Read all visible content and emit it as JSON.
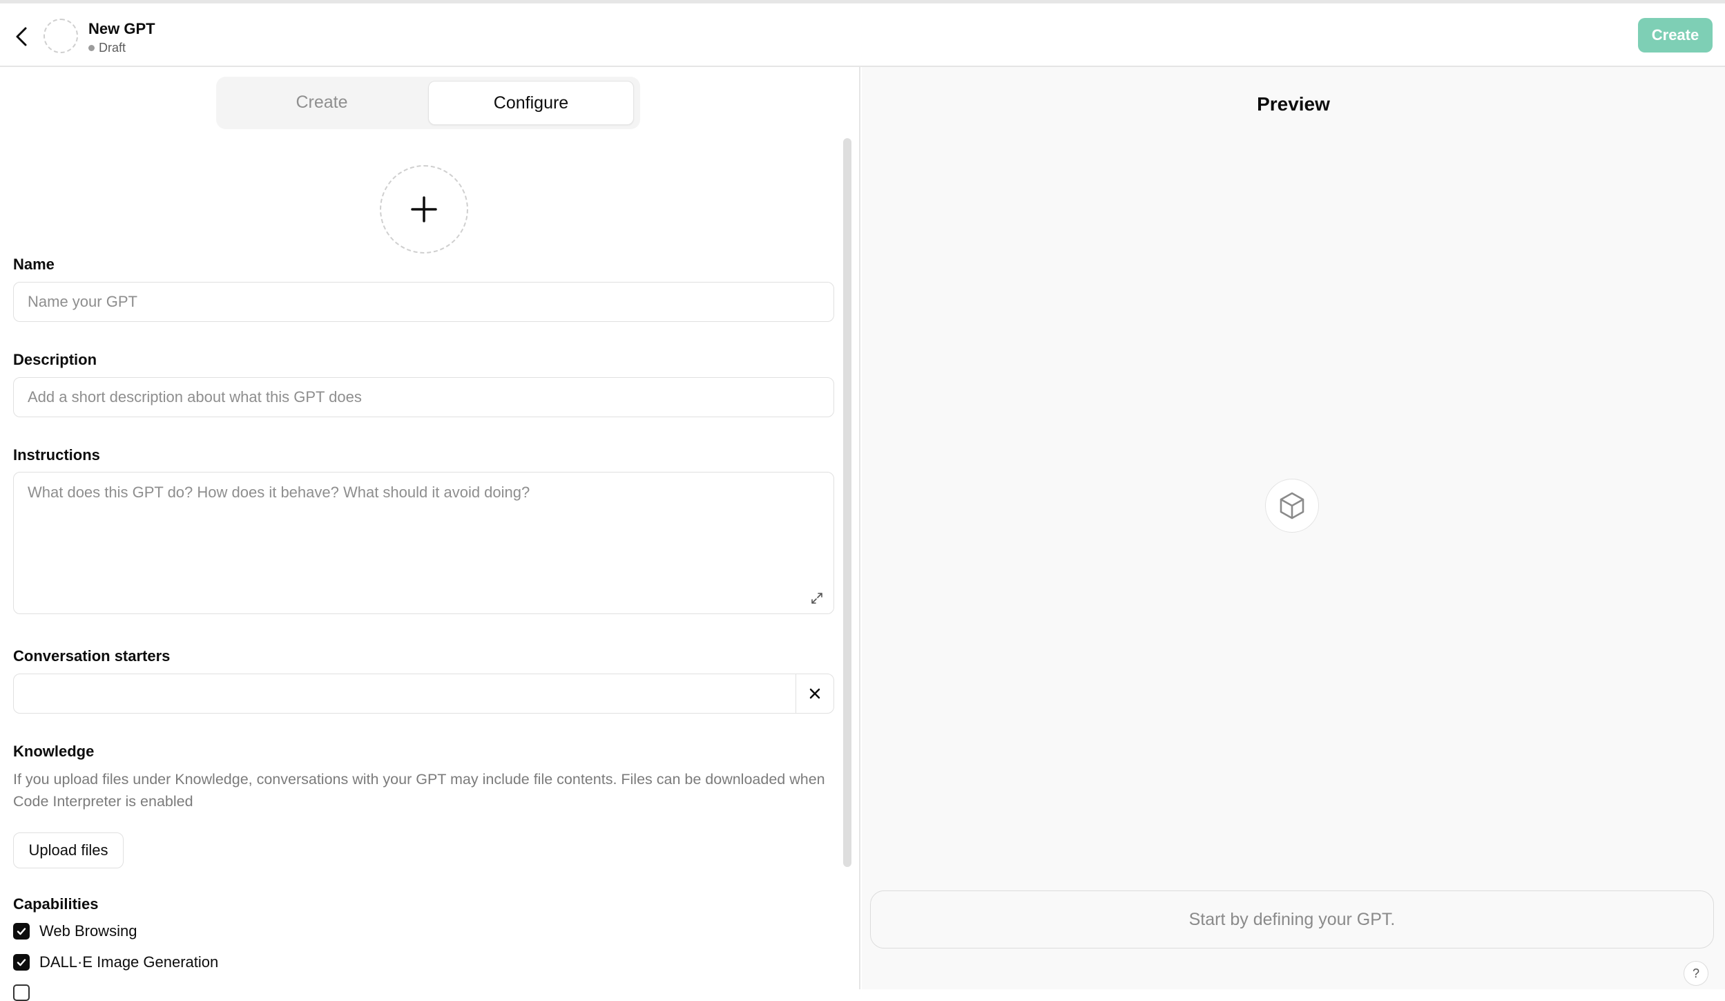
{
  "header": {
    "title": "New GPT",
    "status": "Draft",
    "create_label": "Create"
  },
  "tabs": [
    {
      "label": "Create",
      "active": false
    },
    {
      "label": "Configure",
      "active": true
    }
  ],
  "form": {
    "name": {
      "label": "Name",
      "placeholder": "Name your GPT",
      "value": ""
    },
    "description": {
      "label": "Description",
      "placeholder": "Add a short description about what this GPT does",
      "value": ""
    },
    "instructions": {
      "label": "Instructions",
      "placeholder": "What does this GPT do? How does it behave? What should it avoid doing?",
      "value": ""
    },
    "conversation_starters": {
      "label": "Conversation starters",
      "values": [
        ""
      ]
    },
    "knowledge": {
      "label": "Knowledge",
      "description": "If you upload files under Knowledge, conversations with your GPT may include file contents. Files can be downloaded when Code Interpreter is enabled",
      "upload_label": "Upload files"
    },
    "capabilities": {
      "label": "Capabilities",
      "items": [
        {
          "label": "Web Browsing",
          "checked": true
        },
        {
          "label": "DALL·E Image Generation",
          "checked": true
        }
      ]
    }
  },
  "preview": {
    "title": "Preview",
    "placeholder": "Start by defining your GPT.",
    "help_label": "?"
  },
  "colors": {
    "accent": "#7ecfb5",
    "panel_bg": "#f9f9f9"
  }
}
